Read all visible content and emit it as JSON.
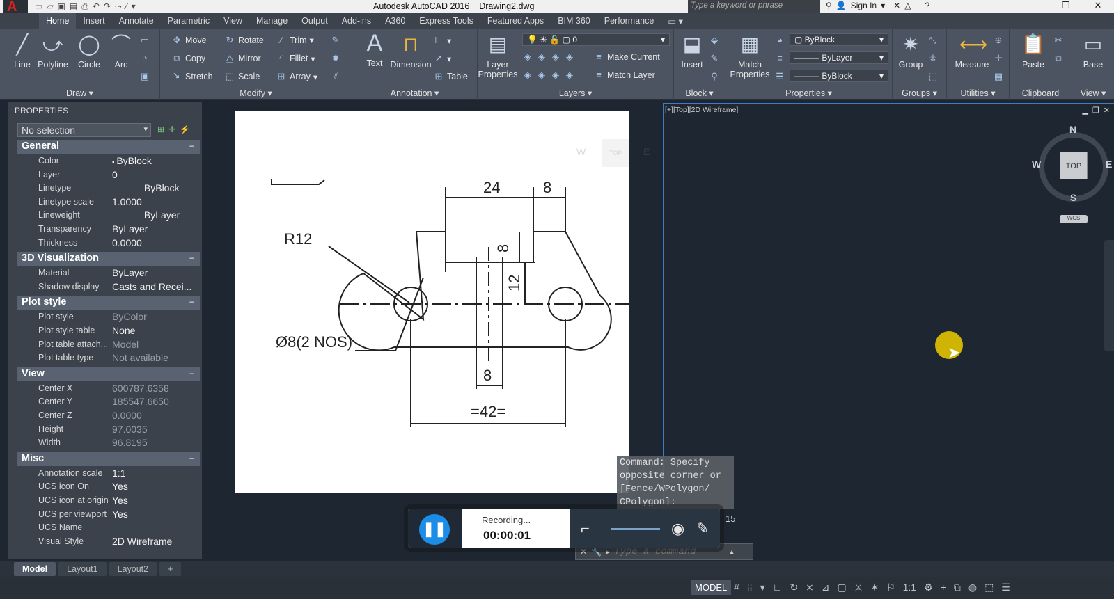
{
  "titlebar": {
    "app_name": "Autodesk AutoCAD 2016",
    "file_name": "Drawing2.dwg",
    "search_placeholder": "Type a keyword or phrase",
    "signin": "Sign In"
  },
  "ribbon_tabs": [
    "Home",
    "Insert",
    "Annotate",
    "Parametric",
    "View",
    "Manage",
    "Output",
    "Add-ins",
    "A360",
    "Express Tools",
    "Featured Apps",
    "BIM 360",
    "Performance"
  ],
  "ribbon": {
    "draw": {
      "title": "Draw",
      "line": "Line",
      "polyline": "Polyline",
      "circle": "Circle",
      "arc": "Arc"
    },
    "modify": {
      "title": "Modify",
      "move": "Move",
      "rotate": "Rotate",
      "trim": "Trim",
      "copy": "Copy",
      "mirror": "Mirror",
      "fillet": "Fillet",
      "stretch": "Stretch",
      "scale": "Scale",
      "array": "Array"
    },
    "annotation": {
      "title": "Annotation",
      "text": "Text",
      "dimension": "Dimension",
      "table": "Table"
    },
    "layers": {
      "title": "Layers",
      "layer_properties_1": "Layer",
      "layer_properties_2": "Properties",
      "current_layer": "0",
      "make_current": "Make Current",
      "match_layer": "Match Layer"
    },
    "block": {
      "title": "Block",
      "insert": "Insert"
    },
    "properties": {
      "title": "Properties",
      "match_1": "Match",
      "match_2": "Properties",
      "color": "ByBlock",
      "linetype": "ByLayer",
      "lineweight": "ByBlock"
    },
    "groups": {
      "title": "Groups",
      "group": "Group"
    },
    "utilities": {
      "title": "Utilities",
      "measure": "Measure"
    },
    "clipboard": {
      "title": "Clipboard",
      "paste": "Paste"
    },
    "view": {
      "title": "View",
      "base": "Base"
    }
  },
  "properties_palette": {
    "header": "PROPERTIES",
    "selection": "No selection",
    "general": {
      "title": "General",
      "rows": [
        {
          "k": "Color",
          "v": "ByBlock"
        },
        {
          "k": "Layer",
          "v": "0"
        },
        {
          "k": "Linetype",
          "v": "ByBlock"
        },
        {
          "k": "Linetype scale",
          "v": "1.0000"
        },
        {
          "k": "Lineweight",
          "v": "ByLayer"
        },
        {
          "k": "Transparency",
          "v": "ByLayer"
        },
        {
          "k": "Thickness",
          "v": "0.0000"
        }
      ]
    },
    "viz3d": {
      "title": "3D Visualization",
      "rows": [
        {
          "k": "Material",
          "v": "ByLayer"
        },
        {
          "k": "Shadow display",
          "v": "Casts and Recei..."
        }
      ]
    },
    "plot": {
      "title": "Plot style",
      "rows": [
        {
          "k": "Plot style",
          "v": "ByColor"
        },
        {
          "k": "Plot style table",
          "v": "None"
        },
        {
          "k": "Plot table attach...",
          "v": "Model"
        },
        {
          "k": "Plot table type",
          "v": "Not available"
        }
      ]
    },
    "view": {
      "title": "View",
      "rows": [
        {
          "k": "Center X",
          "v": "600787.6358"
        },
        {
          "k": "Center Y",
          "v": "185547.6650"
        },
        {
          "k": "Center Z",
          "v": "0.0000"
        },
        {
          "k": "Height",
          "v": "97.0035"
        },
        {
          "k": "Width",
          "v": "96.8195"
        }
      ]
    },
    "misc": {
      "title": "Misc",
      "rows": [
        {
          "k": "Annotation scale",
          "v": "1:1"
        },
        {
          "k": "UCS icon On",
          "v": "Yes"
        },
        {
          "k": "UCS icon at origin",
          "v": "Yes"
        },
        {
          "k": "UCS per viewport",
          "v": "Yes"
        },
        {
          "k": "UCS Name",
          "v": ""
        },
        {
          "k": "Visual Style",
          "v": "2D Wireframe"
        }
      ]
    }
  },
  "viewport": {
    "label": "[+][Top][2D Wireframe]",
    "viewcube": {
      "top": "TOP",
      "n": "N",
      "s": "S",
      "e": "E",
      "w": "W",
      "wcs": "WCS"
    }
  },
  "drawing": {
    "dim_24": "24",
    "dim_8_top": "8",
    "dim_8_vert": "8",
    "dim_12": "12",
    "dim_8_bottom": "8",
    "dim_42": "=42=",
    "radius": "R12",
    "holes": "Ø8(2 NOS)"
  },
  "command": {
    "history": [
      "Command: Specify",
      "opposite corner or",
      "[Fence/WPolygon/",
      "CPolygon]:"
    ],
    "number": "15",
    "placeholder": "Type a command"
  },
  "recorder": {
    "status": "Recording...",
    "time": "00:00:01"
  },
  "layout_tabs": [
    "Model",
    "Layout1",
    "Layout2",
    "+"
  ],
  "statusbar": {
    "model": "MODEL",
    "scale": "1:1"
  }
}
